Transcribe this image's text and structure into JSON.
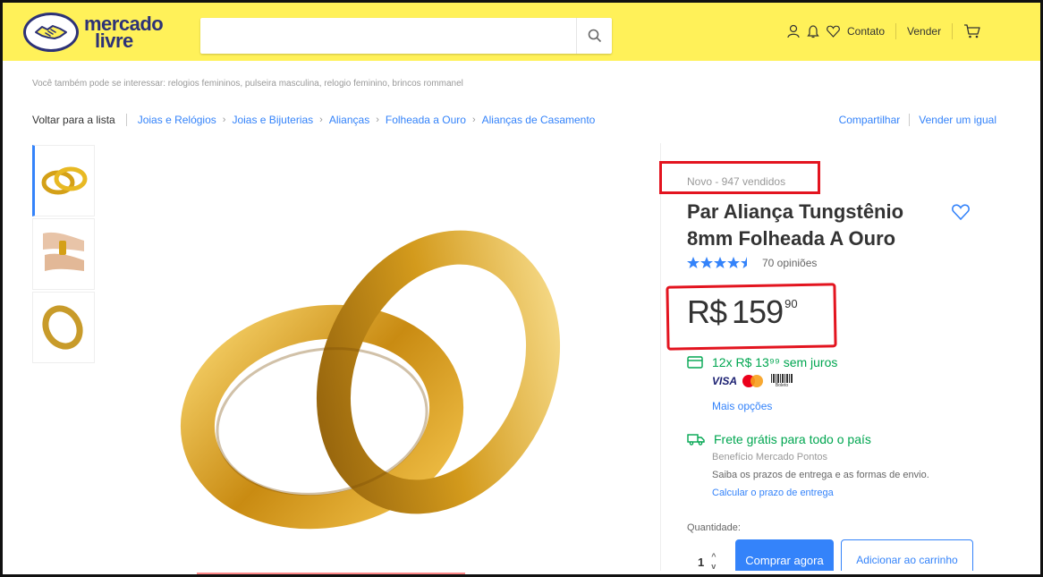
{
  "header": {
    "logo_line1": "mercado",
    "logo_line2": "livre",
    "search": {
      "placeholder": "",
      "value": ""
    },
    "nav": {
      "contact": "Contato",
      "sell": "Vender"
    },
    "colors": {
      "background": "#fff159",
      "brand": "#2d3277"
    }
  },
  "suggestion": "Você também pode se interessar: relogios femininos, pulseira masculina, relogio feminino, brincos rommanel",
  "breadcrumb": {
    "back": "Voltar para a lista",
    "items": [
      "Joias e Relógios",
      "Joias e Bijuterias",
      "Alianças",
      "Folheada a Ouro",
      "Alianças de Casamento"
    ],
    "share": "Compartilhar",
    "sell_same": "Vender um igual"
  },
  "gallery": {
    "thumbnails": [
      "rings-thumb-1",
      "rings-on-hand-thumb",
      "rings-thumb-3"
    ],
    "active_index": 0
  },
  "product": {
    "condition": "Novo  -  947 vendidos",
    "title": "Par Aliança Tungstênio 8mm Folheada A Ouro",
    "rating": 4.5,
    "reviews": "70 opiniões",
    "price": {
      "currency": "R$",
      "integer": "159",
      "cents": "90"
    },
    "installments": "12x R$ 13⁹⁹ sem juros",
    "payment_methods": [
      "VISA",
      "Mastercard",
      "Boleto"
    ],
    "more_options": "Mais opções",
    "shipping": {
      "title": "Frete grátis para todo o país",
      "benefit": "Benefício Mercado Pontos",
      "info": "Saiba os prazos de entrega e as formas de envio.",
      "calc_link": "Calcular o prazo de entrega"
    },
    "quantity_label": "Quantidade:",
    "quantity": "1",
    "buy_now": "Comprar agora",
    "add_to_cart": "Adicionar ao carrinho"
  },
  "colors": {
    "accent": "#3483fa",
    "success": "#00a650",
    "highlight": "#e3141f"
  }
}
